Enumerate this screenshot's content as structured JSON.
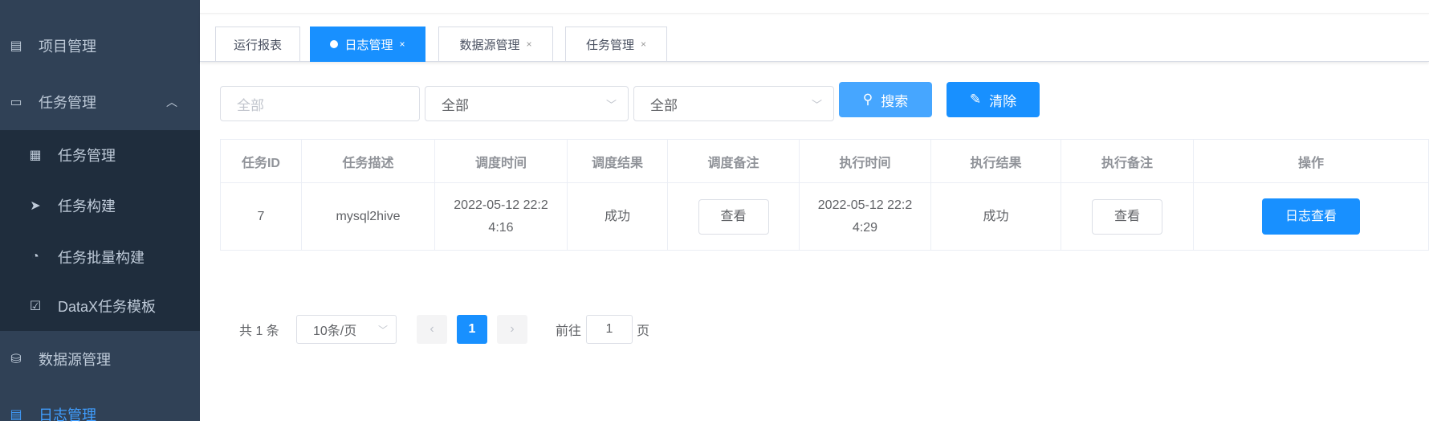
{
  "sidebar": {
    "items": [
      {
        "label": "项目管理",
        "icon": "project-icon"
      },
      {
        "label": "任务管理",
        "icon": "monitor-icon",
        "expanded": true,
        "children": [
          {
            "label": "任务管理",
            "icon": "calendar-icon"
          },
          {
            "label": "任务构建",
            "icon": "send-icon"
          },
          {
            "label": "任务批量构建",
            "icon": "dashboard-icon"
          },
          {
            "label": "DataX任务模板",
            "icon": "clipboard-icon"
          }
        ]
      },
      {
        "label": "数据源管理",
        "icon": "database-icon"
      },
      {
        "label": "日志管理",
        "icon": "document-icon",
        "active": true
      }
    ]
  },
  "tabs": [
    {
      "label": "运行报表"
    },
    {
      "label": "日志管理",
      "active": true,
      "close": "×"
    },
    {
      "label": "数据源管理",
      "close": "×"
    },
    {
      "label": "任务管理",
      "close": "×"
    }
  ],
  "filters": {
    "input_placeholder": "全部",
    "select1": "全部",
    "select2": "全部",
    "search_label": "搜索",
    "clear_label": "清除"
  },
  "table": {
    "columns": [
      "任务ID",
      "任务描述",
      "调度时间",
      "调度结果",
      "调度备注",
      "执行时间",
      "执行结果",
      "执行备注",
      "操作"
    ],
    "rows": [
      {
        "id": "7",
        "desc": "mysql2hive",
        "trigger_time": "2022-05-12 22:24:16",
        "trigger_result": "成功",
        "trigger_note": "查看",
        "exec_time": "2022-05-12 22:24:29",
        "exec_result": "成功",
        "exec_note": "查看",
        "action": "日志查看"
      }
    ]
  },
  "pagination": {
    "total": "共 1 条",
    "page_size": "10条/页",
    "current": "1",
    "goto_prefix": "前往",
    "goto_value": "1",
    "goto_suffix": "页"
  },
  "colors": {
    "primary": "#1890ff",
    "sidebar": "#304156",
    "submenu": "#1f2d3d"
  }
}
